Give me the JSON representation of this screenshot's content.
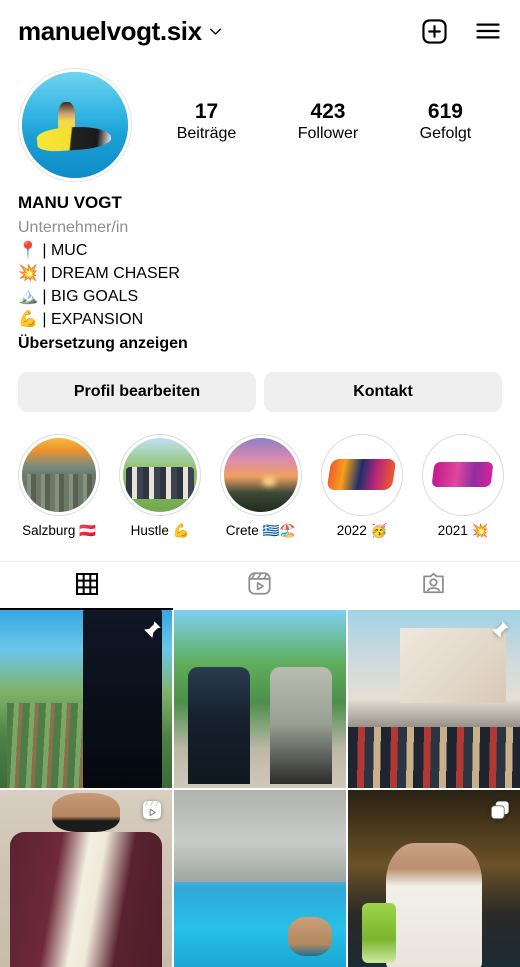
{
  "header": {
    "username": "manuelvogt.six",
    "chevron_icon": "chevron-down-icon",
    "add_icon": "plus-square-icon",
    "menu_icon": "hamburger-menu-icon"
  },
  "profile": {
    "avatar_alt": "jet-ski-avatar",
    "stats": [
      {
        "value": "17",
        "label": "Beiträge"
      },
      {
        "value": "423",
        "label": "Follower"
      },
      {
        "value": "619",
        "label": "Gefolgt"
      }
    ],
    "bio": {
      "name": "MANU VOGT",
      "category": "Unternehmer/in",
      "lines": [
        "📍 | MUC",
        "💥 | DREAM CHASER",
        "🏔️ | BIG GOALS",
        "💪 | EXPANSION"
      ],
      "translate_label": "Übersetzung anzeigen"
    }
  },
  "actions": {
    "edit_profile_label": "Profil bearbeiten",
    "contact_label": "Kontakt"
  },
  "highlights": [
    {
      "label": "Salzburg 🇦🇹",
      "cover": "salzburg-city-cover"
    },
    {
      "label": "Hustle 💪",
      "cover": "group-photo-cover"
    },
    {
      "label": "Crete 🇬🇷🏖️",
      "cover": "crete-sunset-cover"
    },
    {
      "label": "2022 🥳",
      "cover": "2022-text-cover"
    },
    {
      "label": "2021 💥",
      "cover": "2021-text-cover"
    },
    {
      "label": "",
      "cover": "partial-cover"
    }
  ],
  "tabs": [
    {
      "name": "grid",
      "icon": "grid-icon",
      "active": true
    },
    {
      "name": "reels",
      "icon": "reels-icon",
      "active": false
    },
    {
      "name": "tagged",
      "icon": "tagged-person-icon",
      "active": false
    }
  ],
  "grid_posts": [
    {
      "alt": "man-in-suit-at-window",
      "badge": "pin-icon"
    },
    {
      "alt": "two-men-with-briefcases",
      "badge": ""
    },
    {
      "alt": "presentation-speaker-on-stage",
      "badge": "pin-icon"
    },
    {
      "alt": "man-in-burgundy-suit-sunglasses",
      "badge": "reels-icon"
    },
    {
      "alt": "pool-resort-scene",
      "badge": ""
    },
    {
      "alt": "man-at-night-restaurant-with-drink",
      "badge": "carousel-icon"
    }
  ],
  "colors": {
    "background": "#ffffff",
    "text": "#000000",
    "muted_text": "#8e8e8e",
    "button_bg": "#efefef",
    "divider": "#efefef",
    "ring": "#dbdbdb"
  }
}
